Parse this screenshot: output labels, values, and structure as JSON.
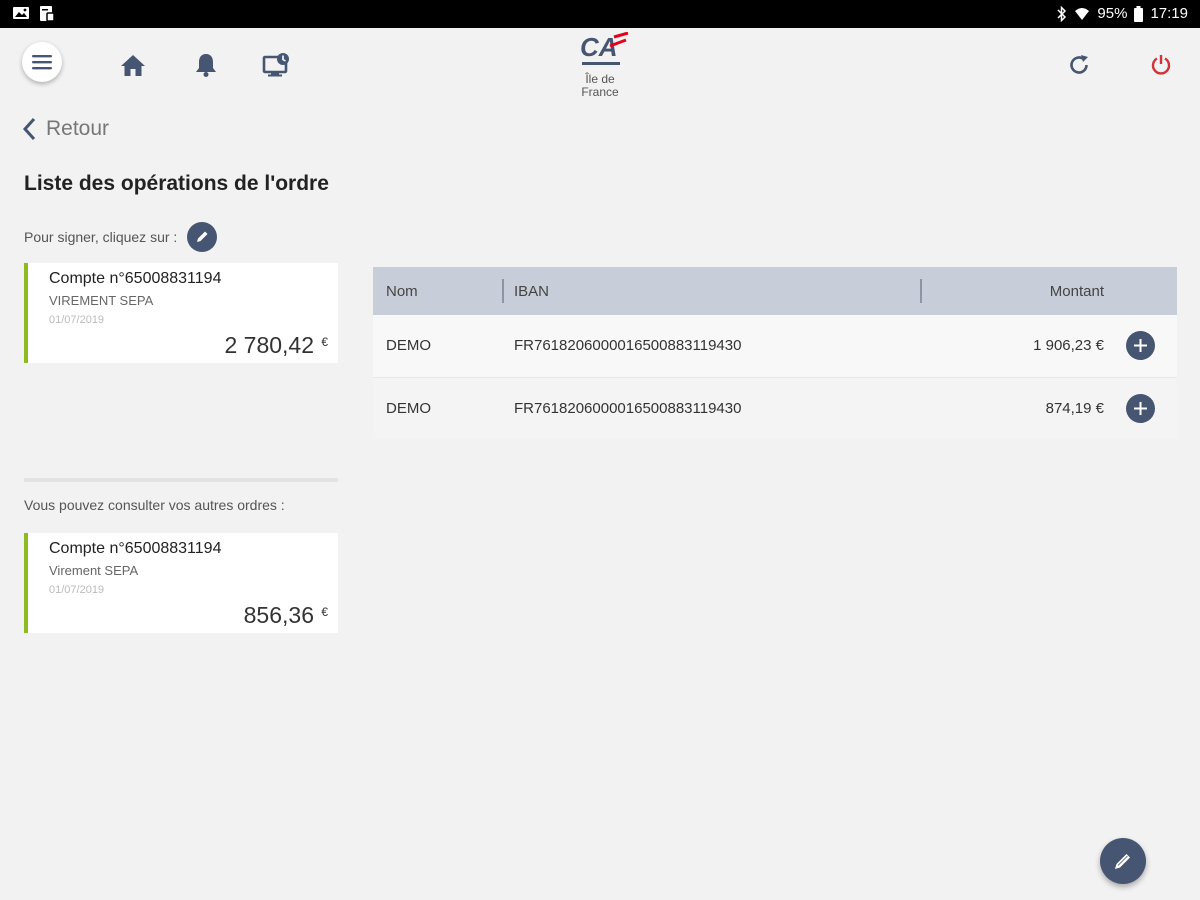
{
  "status_bar": {
    "battery": "95%",
    "time": "17:19",
    "icons": [
      "gallery-icon",
      "download-icon",
      "bluetooth-icon",
      "wifi-icon",
      "battery-icon"
    ]
  },
  "header": {
    "icons": [
      "menu-icon",
      "home-icon",
      "bell-icon",
      "screen-icon",
      "refresh-icon",
      "power-icon"
    ],
    "logo": {
      "mark": "CA",
      "line1": "Île de",
      "line2": "France"
    },
    "colors": {
      "accent": "#465571",
      "logo_red": "#e2001a",
      "power_red": "#d0343a"
    }
  },
  "back_label": "Retour",
  "page_title": "Liste des opérations de l'ordre",
  "sign_hint": "Pour signer, cliquez sur :",
  "current_order": {
    "account": "Compte n°65008831194",
    "type": "VIREMENT SEPA",
    "date": "01/07/2019",
    "amount": "2 780,42",
    "currency": "€"
  },
  "other_orders_hint": "Vous pouvez consulter vos autres ordres :",
  "other_orders": [
    {
      "account": "Compte n°65008831194",
      "type": "Virement SEPA",
      "date": "01/07/2019",
      "amount": "856,36",
      "currency": "€"
    }
  ],
  "operations_table": {
    "columns": [
      "Nom",
      "IBAN",
      "Montant"
    ],
    "rows": [
      {
        "nom": "DEMO",
        "iban": "FR7618206000016500883119430",
        "montant": "1 906,23 €"
      },
      {
        "nom": "DEMO",
        "iban": "FR7618206000016500883119430",
        "montant": "874,19 €"
      }
    ]
  },
  "card_accent_color": "#8fbb22"
}
